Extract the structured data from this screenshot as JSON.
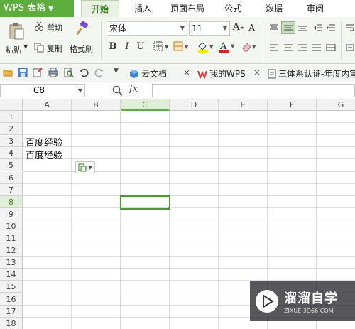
{
  "app": {
    "name": "WPS 表格",
    "dropdown_icon": "caret-down-icon"
  },
  "tabs": [
    {
      "label": "开始",
      "active": true
    },
    {
      "label": "插入"
    },
    {
      "label": "页面布局"
    },
    {
      "label": "公式"
    },
    {
      "label": "数据"
    },
    {
      "label": "审阅"
    }
  ],
  "ribbon": {
    "paste_label": "粘贴",
    "cut_label": "剪切",
    "copy_label": "复制",
    "format_painter_label": "格式刷",
    "font_name": "宋体",
    "font_size": "11",
    "bold": "B",
    "italic": "I",
    "underline": "U",
    "increase_font": "A",
    "decrease_font": "A"
  },
  "quickbar": {
    "doc_tabs": [
      {
        "label": "云文档",
        "icon": "cloud-cube-icon"
      },
      {
        "label": "我的WPS",
        "icon": "wps-w-icon"
      },
      {
        "label": "三体系认证-年度内审",
        "icon": "document-icon"
      }
    ],
    "close_glyph": "×"
  },
  "formula_bar": {
    "name_box": "C8",
    "fx": "fx",
    "value": ""
  },
  "sheet": {
    "columns": [
      "A",
      "B",
      "C",
      "D",
      "E",
      "F",
      "G"
    ],
    "rows": [
      "1",
      "2",
      "3",
      "4",
      "5",
      "6",
      "7",
      "8",
      "9",
      "10",
      "11",
      "12",
      "13",
      "14",
      "15",
      "16",
      "17",
      "18"
    ],
    "selected_cell": "C8",
    "selected_column": "C",
    "selected_row": "8",
    "cells": {
      "A3": "百度经验",
      "A4": "百度经验"
    }
  },
  "watermark": {
    "title": "溜溜自学",
    "url": "ZIXUE.3D66.COM"
  },
  "colors": {
    "accent": "#5cad3c",
    "selection": "#4b9b2c"
  }
}
